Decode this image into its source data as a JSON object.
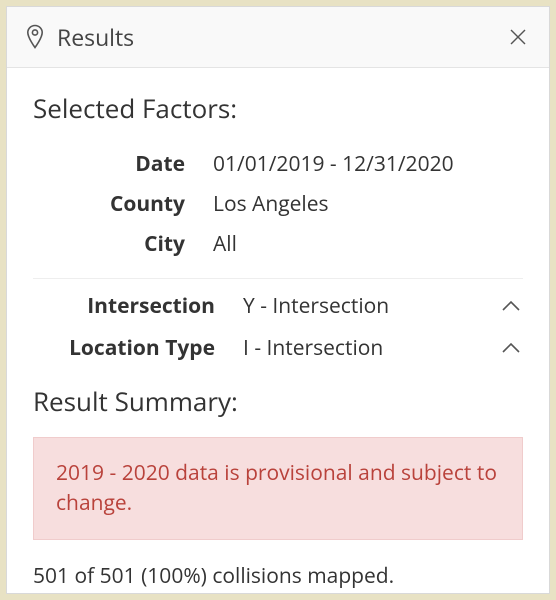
{
  "header": {
    "title": "Results"
  },
  "selected_factors": {
    "heading": "Selected Factors:",
    "rows": [
      {
        "label": "Date",
        "value": "01/01/2019 - 12/31/2020"
      },
      {
        "label": "County",
        "value": "Los Angeles"
      },
      {
        "label": "City",
        "value": "All"
      }
    ]
  },
  "accordion": {
    "rows": [
      {
        "label": "Intersection",
        "value": "Y - Intersection"
      },
      {
        "label": "Location Type",
        "value": "I - Intersection"
      }
    ]
  },
  "summary": {
    "heading": "Result Summary:",
    "alert": "2019 - 2020 data is provisional and subject to change.",
    "mapped": "501 of 501 (100%) collisions mapped."
  }
}
